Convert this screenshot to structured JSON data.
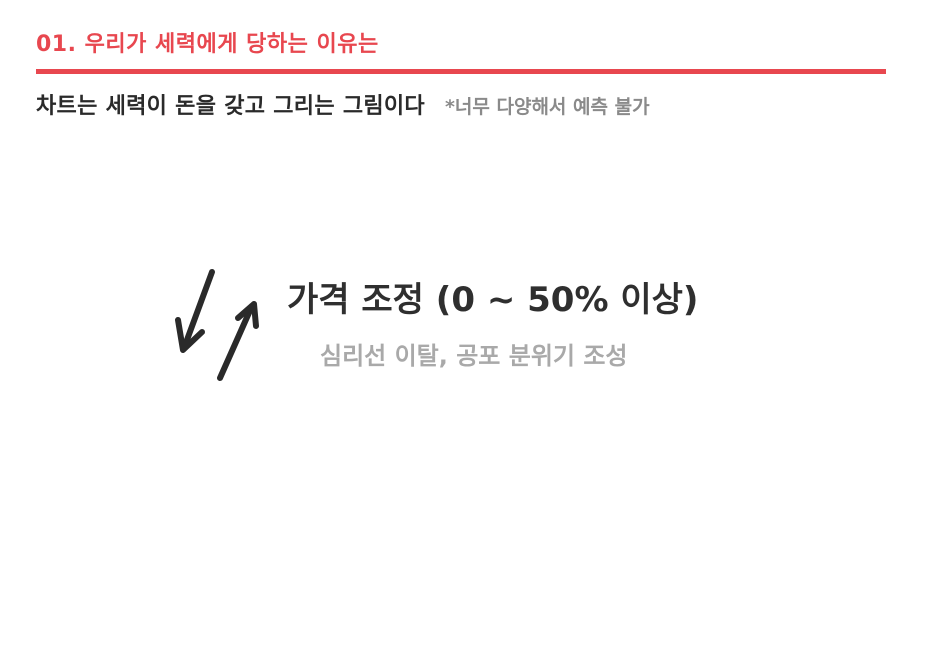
{
  "header": {
    "section_title": "01. 우리가 세력에게 당하는 이유는",
    "accent_color": "#e8474f"
  },
  "subtitle": {
    "text": "차트는 세력이 돈을 갖고 그리는 그림이다",
    "note": "*너무 다양해서 예측 불가"
  },
  "main": {
    "icon": "up-down-arrows-icon",
    "heading": "가격 조정 (0 ~ 50% 이상)",
    "description": "심리선 이탈, 공포 분위기 조성"
  }
}
